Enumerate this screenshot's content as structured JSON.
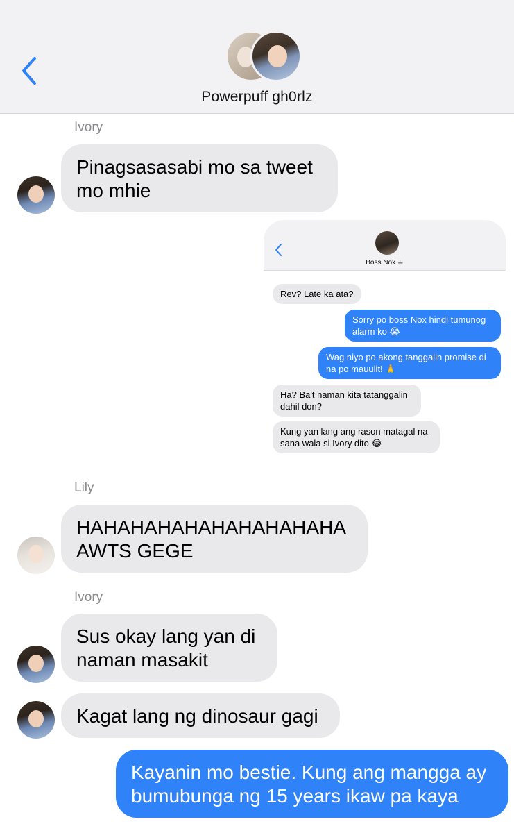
{
  "header": {
    "group_name": "Powerpuff gh0rlz",
    "back_icon": "chevron-left-icon",
    "accent_color": "#2f82f7"
  },
  "messages": [
    {
      "sender": "Ivory",
      "text_lines": [
        "Pinagsasasabi mo sa tweet",
        "mo mhie"
      ]
    },
    {
      "sender": "Lily",
      "text_lines": [
        "HAHAHAHAHAHAHAHAHAHA",
        "AWTS GEGE"
      ]
    },
    {
      "sender": "Ivory",
      "text_lines": [
        "Sus okay lang yan di",
        "naman masakit"
      ]
    },
    {
      "text_lines": [
        "Kagat lang ng dinosaur gagi"
      ]
    },
    {
      "text_lines": [
        "Kayanin mo bestie. Kung ang mangga ay",
        "bumubunga ng 15 years ikaw pa kaya"
      ]
    }
  ],
  "screenshot": {
    "contact_name": "Boss Nox ☕",
    "messages": [
      {
        "lines": [
          "Rev? Late ka ata?"
        ]
      },
      {
        "lines": [
          "Sorry po boss Nox hindi tumunog",
          "alarm ko 😭"
        ]
      },
      {
        "lines": [
          "Wag niyo po akong tanggalin promise di",
          "na po mauulit! 🙏"
        ]
      },
      {
        "lines": [
          "Ha? Ba't naman kita tatanggalin",
          "dahil don?"
        ]
      },
      {
        "lines": [
          "Kung yan lang ang rason matagal na",
          "sana wala si Ivory dito 😂"
        ]
      }
    ]
  }
}
